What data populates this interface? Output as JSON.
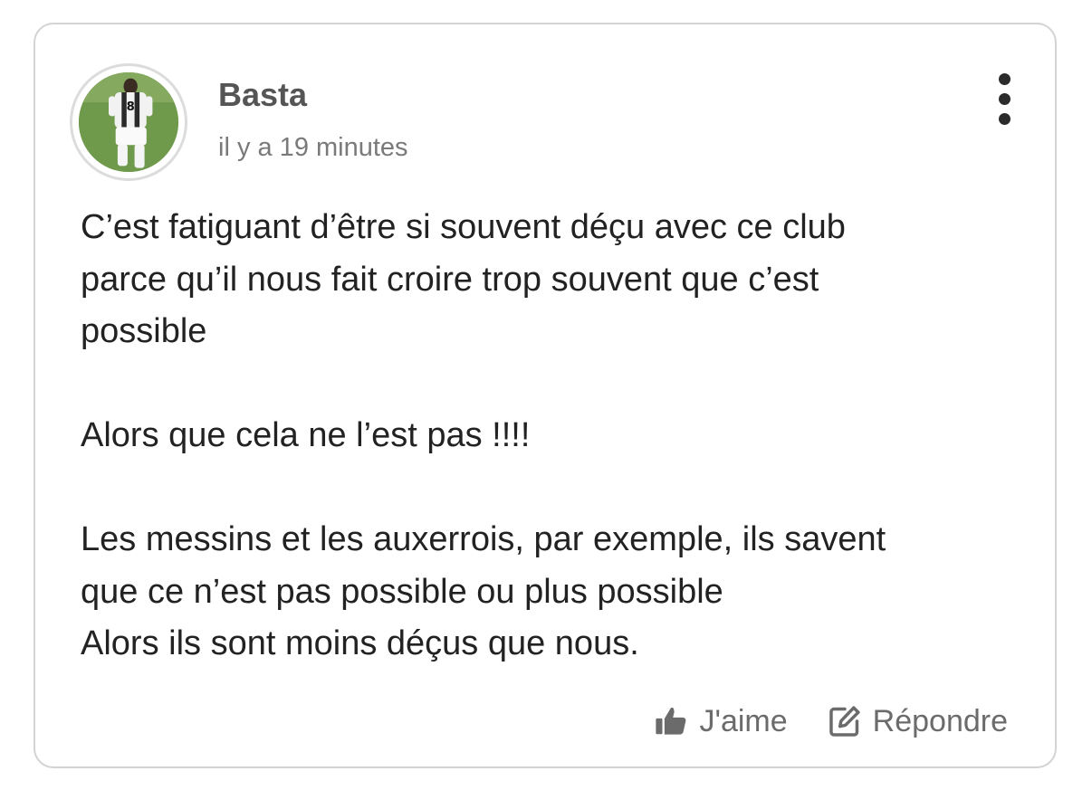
{
  "comment": {
    "author": "Basta",
    "timestamp": "il y a 19 minutes",
    "avatar_icon": "player-photo-avatar",
    "paragraphs": [
      [
        "C’est fatiguant d’être si souvent déçu avec ce club",
        "parce qu’il nous fait croire trop souvent que c’est",
        "possible"
      ],
      [
        "Alors que cela ne l’est pas !!!!"
      ],
      [
        "Les messins et les auxerrois, par exemple, ils savent",
        "que ce n’est pas possible ou plus possible",
        "Alors ils sont moins déçus que nous."
      ]
    ]
  },
  "menu": {
    "icon": "more-vertical-icon"
  },
  "actions": {
    "like_label": "J'aime",
    "like_icon": "thumbs-up-icon",
    "reply_label": "Répondre",
    "reply_icon": "edit-reply-icon"
  },
  "colors": {
    "border": "#d3d3d3",
    "author": "#555555",
    "muted": "#7a7a7a",
    "body_text": "#222222",
    "action_text": "#6b6b6b"
  }
}
